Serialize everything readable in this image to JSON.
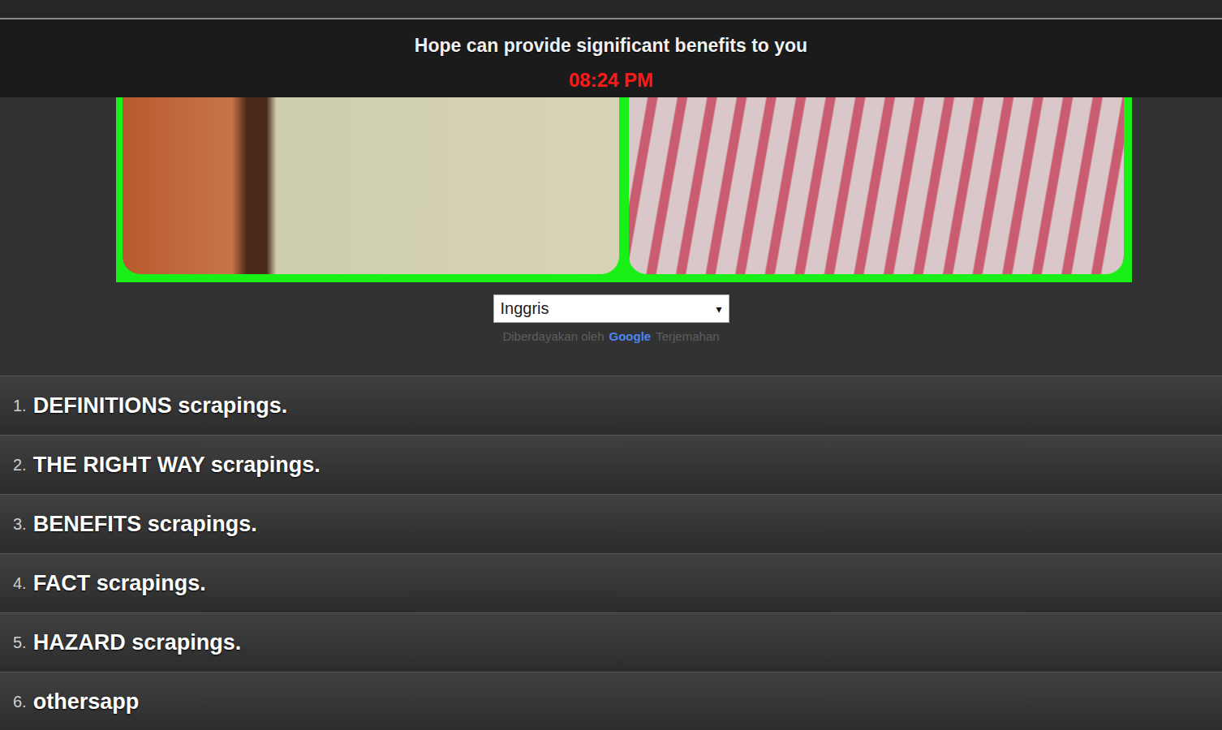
{
  "header": {
    "message": "Hope can provide significant benefits to you",
    "time": "08:24 PM"
  },
  "translate": {
    "language": "Inggris",
    "arrow": "▾",
    "powered_by": "Diberdayakan oleh",
    "brand": "Google",
    "suffix": "Terjemahan"
  },
  "menu": [
    {
      "number": "1.",
      "label": "DEFINITIONS scrapings."
    },
    {
      "number": "2.",
      "label": "THE RIGHT WAY scrapings."
    },
    {
      "number": "3.",
      "label": "BENEFITS scrapings."
    },
    {
      "number": "4.",
      "label": "FACT scrapings."
    },
    {
      "number": "5.",
      "label": "HAZARD scrapings."
    },
    {
      "number": "6.",
      "label": "othersapp"
    }
  ]
}
